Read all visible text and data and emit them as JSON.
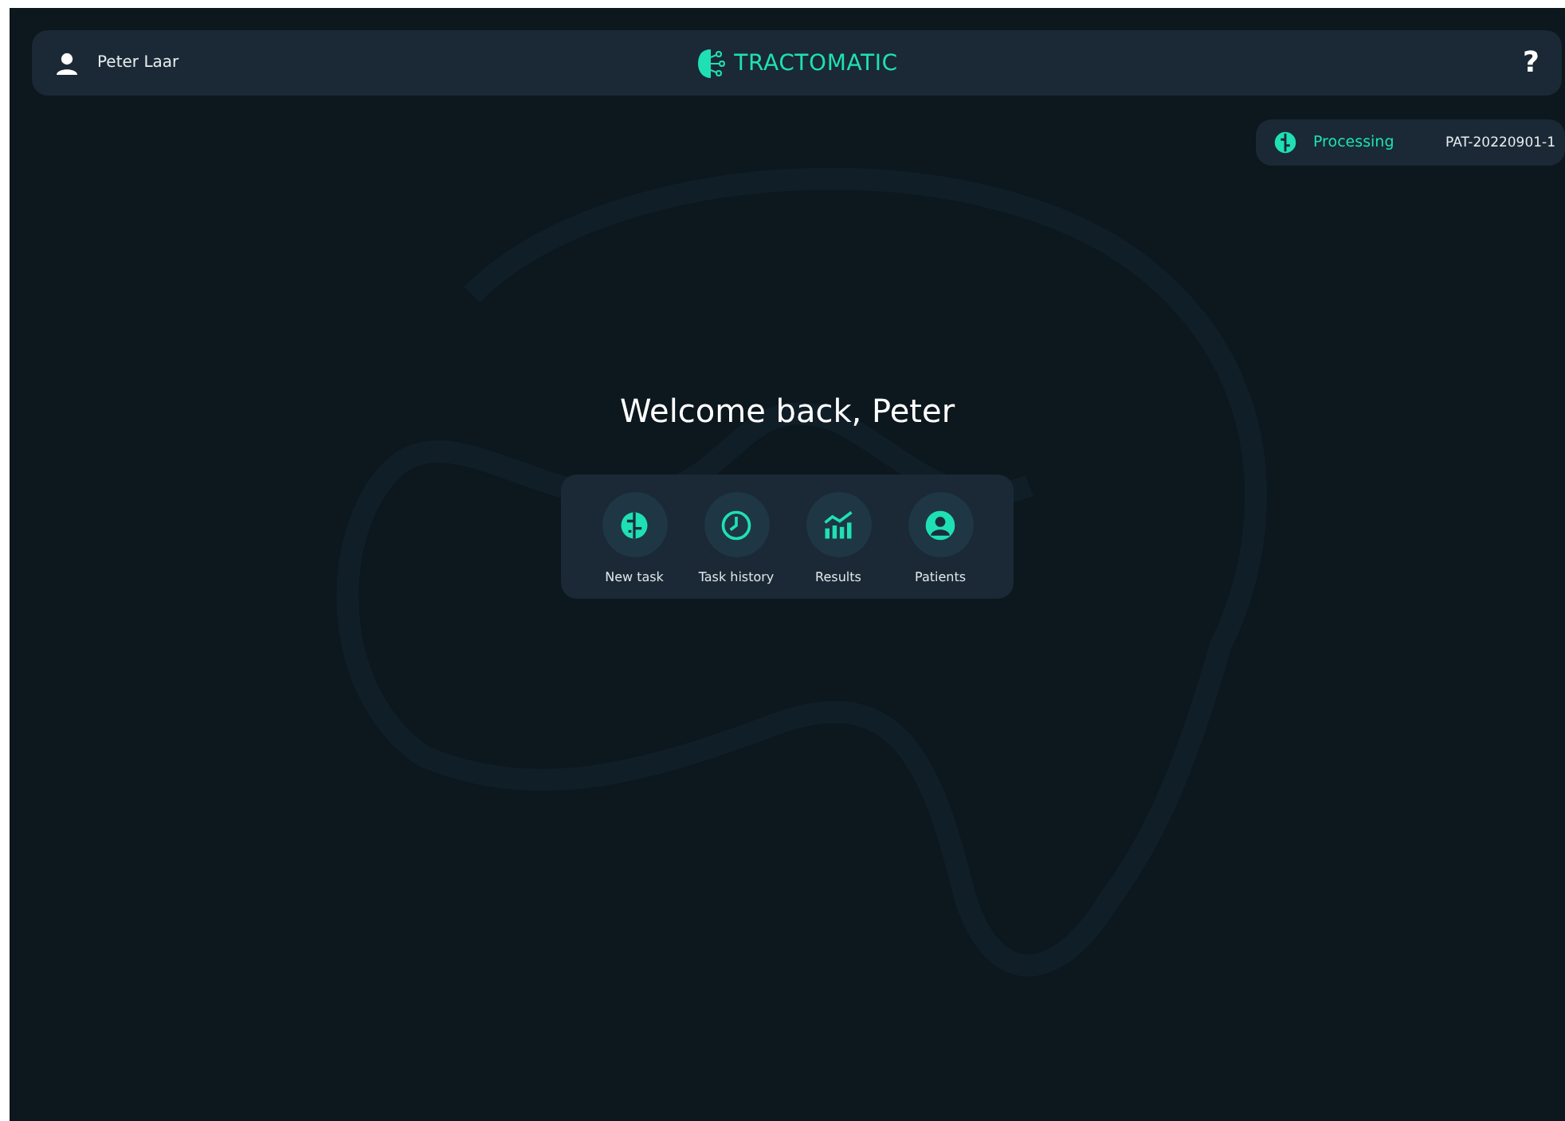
{
  "header": {
    "user_name": "Peter Laar",
    "logo_text": "TRACTOMATIC",
    "help": "?"
  },
  "status": {
    "label": "Processing",
    "patient_id": "PAT-20220901-1"
  },
  "welcome": "Welcome back, Peter",
  "actions": [
    {
      "label": "New task"
    },
    {
      "label": "Task history"
    },
    {
      "label": "Results"
    },
    {
      "label": "Patients"
    }
  ]
}
